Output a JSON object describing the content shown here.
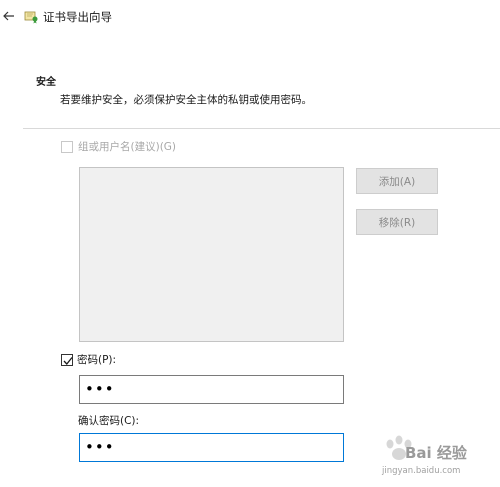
{
  "window": {
    "title": "证书导出向导"
  },
  "header": {
    "heading": "安全",
    "description": "若要维护安全，必须保护安全主体的私钥或使用密码。"
  },
  "group_option": {
    "label": "组或用户名(建议)(G)",
    "checked": false,
    "enabled": false
  },
  "buttons": {
    "add_label": "添加(A)",
    "remove_label": "移除(R)"
  },
  "password": {
    "checkbox_label": "密码(P):",
    "checked": true,
    "value": "•••",
    "confirm_label": "确认密码(C):",
    "confirm_value": "•••"
  },
  "watermark": {
    "text": "Bai 经验",
    "sub": "jingyan.baidu.com"
  },
  "colors": {
    "focus_border": "#0078d7",
    "disabled_text": "#a8a8a8"
  }
}
